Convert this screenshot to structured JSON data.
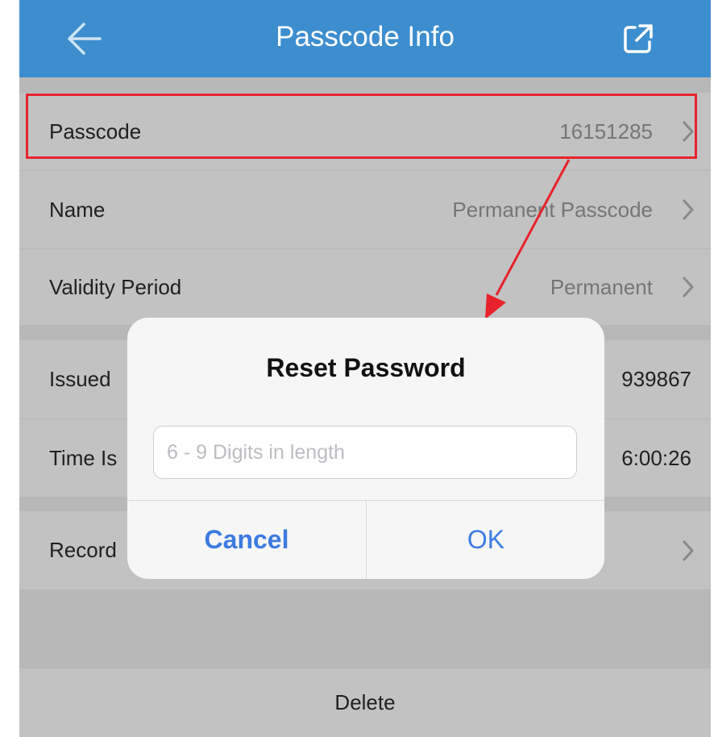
{
  "header": {
    "title": "Passcode Info",
    "back_icon": "back-arrow-icon",
    "share_icon": "share-icon"
  },
  "rows": {
    "passcode": {
      "label": "Passcode",
      "value": "16151285"
    },
    "name": {
      "label": "Name",
      "value": "Permanent Passcode"
    },
    "validity": {
      "label": "Validity Period",
      "value": "Permanent"
    },
    "issued_by": {
      "label": "Issued",
      "value": "939867"
    },
    "time_issued": {
      "label": "Time Is",
      "value": "6:00:26"
    },
    "records": {
      "label": "Record"
    }
  },
  "footer": {
    "delete_label": "Delete"
  },
  "dialog": {
    "title": "Reset Password",
    "input_placeholder": "6 - 9 Digits in length",
    "input_value": "",
    "cancel_label": "Cancel",
    "ok_label": "OK"
  },
  "colors": {
    "header_bg": "#3d8ecf",
    "highlight": "#e8232b",
    "dialog_button": "#3d7be0"
  }
}
